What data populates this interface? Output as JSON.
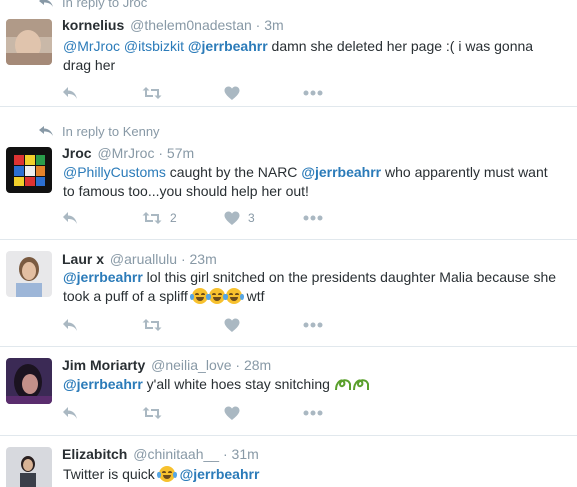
{
  "tweets": [
    {
      "reply_to": "In reply to Jroc",
      "name": "kornelius",
      "handle": "@thelem0nadestan",
      "time": "3m",
      "segments": [
        {
          "t": "@MrJroc",
          "m": true
        },
        {
          "t": " "
        },
        {
          "t": "@itsbizkit",
          "m": true
        },
        {
          "t": " "
        },
        {
          "t": "@jerrbeahrr",
          "m": true,
          "b": true
        },
        {
          "t": " damn she deleted her page :( i was gonna drag her"
        }
      ],
      "retweet_count": "",
      "like_count": ""
    },
    {
      "reply_to": "In reply to Kenny",
      "name": "Jroc",
      "handle": "@MrJroc",
      "time": "57m",
      "segments": [
        {
          "t": "@PhillyCustoms",
          "m": true
        },
        {
          "t": " caught by the NARC "
        },
        {
          "t": "@jerrbeahrr",
          "m": true,
          "b": true
        },
        {
          "t": " who apparently must want to famous too...you should help her out!"
        }
      ],
      "retweet_count": "2",
      "like_count": "3"
    },
    {
      "reply_to": "",
      "name": "Laur x",
      "handle": "@aruallulu",
      "time": "23m",
      "segments": [
        {
          "t": "@jerrbeahrr",
          "m": true,
          "b": true
        },
        {
          "t": " lol this girl snitched on the presidents daughter Malia because she took a puff of a spliff "
        },
        {
          "e": "joy"
        },
        {
          "e": "joy"
        },
        {
          "e": "joy"
        },
        {
          "t": " wtf"
        }
      ],
      "retweet_count": "",
      "like_count": ""
    },
    {
      "reply_to": "",
      "name": "Jim Moriarty",
      "handle": "@neilia_love",
      "time": "28m",
      "segments": [
        {
          "t": "@jerrbeahrr",
          "m": true,
          "b": true
        },
        {
          "t": " y'all white hoes stay snitching "
        },
        {
          "e": "script"
        }
      ],
      "retweet_count": "",
      "like_count": ""
    },
    {
      "reply_to": "",
      "name": "Elizabitch",
      "handle": "@chinitaah__",
      "time": "31m",
      "segments": [
        {
          "t": "Twitter is quick "
        },
        {
          "e": "joy"
        },
        {
          "t": " "
        },
        {
          "t": "@jerrbeahrr",
          "m": true,
          "b": true
        }
      ],
      "retweet_count": "",
      "like_count": ""
    }
  ],
  "separator": "·",
  "colors": {
    "link": "#2b7bb9",
    "meta": "#8899a6",
    "icon": "#aab8c2",
    "border": "#e1e8ed"
  },
  "icons": [
    "reply-icon",
    "retweet-icon",
    "like-icon",
    "more-icon",
    "in-reply-to-icon"
  ]
}
